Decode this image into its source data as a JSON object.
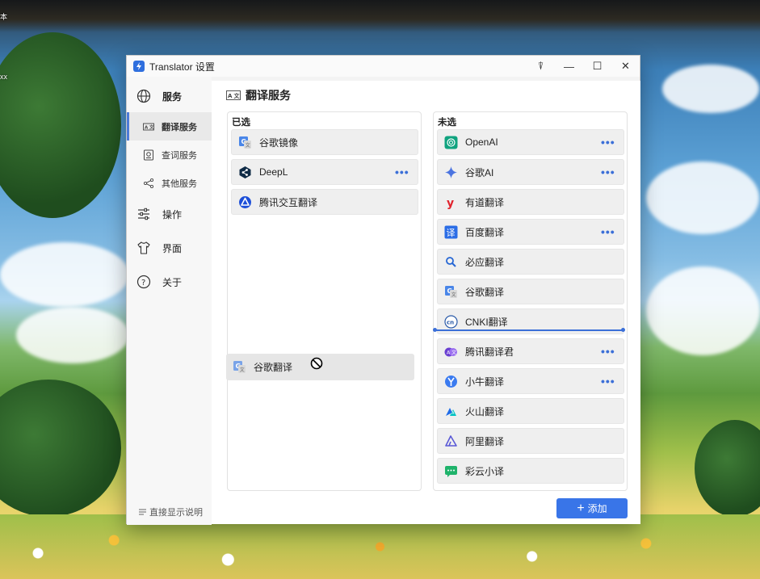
{
  "desktop": {
    "label_a": "本",
    "label_b": "xx"
  },
  "window": {
    "title": "Translator 设置",
    "controls": {
      "pin": "⍒",
      "minimize": "—",
      "maximize": "☐",
      "close": "✕"
    }
  },
  "sidebar": {
    "service": {
      "label": "服务",
      "icon": "globe-icon"
    },
    "sub_items": [
      {
        "label": "翻译服务",
        "icon": "translate-icon",
        "active": true
      },
      {
        "label": "查词服务",
        "icon": "dictionary-icon",
        "active": false
      },
      {
        "label": "其他服务",
        "icon": "nodes-icon",
        "active": false
      }
    ],
    "main_items": [
      {
        "label": "操作",
        "icon": "sliders-icon"
      },
      {
        "label": "界面",
        "icon": "shirt-icon"
      },
      {
        "label": "关于",
        "icon": "question-icon"
      }
    ],
    "help_link": "直接显示说明"
  },
  "content": {
    "page_title": "翻译服务",
    "selected": {
      "title": "已选",
      "items": [
        {
          "label": "谷歌镜像",
          "icon": "google-translate-icon",
          "more": false
        },
        {
          "label": "DeepL",
          "icon": "deepl-icon",
          "more": true
        },
        {
          "label": "腾讯交互翻译",
          "icon": "tencent-transmart-icon",
          "more": false
        }
      ]
    },
    "dragging": {
      "label": "谷歌翻译",
      "icon": "google-translate-icon"
    },
    "unselected": {
      "title": "未选",
      "items": [
        {
          "label": "OpenAI",
          "icon": "openai-icon",
          "more": true
        },
        {
          "label": "谷歌AI",
          "icon": "gemini-icon",
          "more": true
        },
        {
          "label": "有道翻译",
          "icon": "youdao-icon",
          "more": false
        },
        {
          "label": "百度翻译",
          "icon": "baidu-icon",
          "more": true
        },
        {
          "label": "必应翻译",
          "icon": "bing-icon",
          "more": false
        },
        {
          "label": "谷歌翻译",
          "icon": "google-translate-icon",
          "more": false
        },
        {
          "label": "CNKI翻译",
          "icon": "cnki-icon",
          "more": false
        },
        {
          "label": "腾讯翻译君",
          "icon": "tencent-icon",
          "more": true
        },
        {
          "label": "小牛翻译",
          "icon": "niutrans-icon",
          "more": true
        },
        {
          "label": "火山翻译",
          "icon": "volcengine-icon",
          "more": false
        },
        {
          "label": "阿里翻译",
          "icon": "alibaba-icon",
          "more": false
        },
        {
          "label": "彩云小译",
          "icon": "caiyun-icon",
          "more": false
        }
      ]
    },
    "more_glyph": "•••",
    "add_button": "添加",
    "add_plus": "+"
  },
  "colors": {
    "accent": "#3975e8",
    "more_dots": "#3b6fd8"
  }
}
